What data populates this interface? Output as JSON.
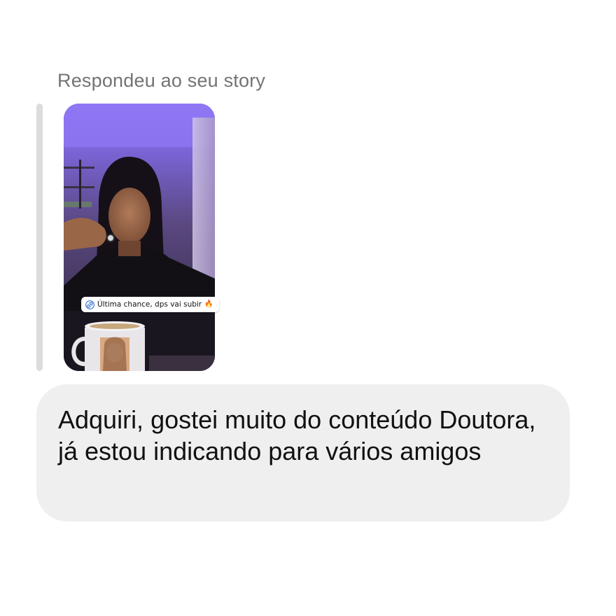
{
  "reply": {
    "caption": "Respondeu ao seu story"
  },
  "story": {
    "sticker_text": "Última chance, dps vai subir",
    "sticker_emoji": "🔥",
    "link_icon": "link-icon",
    "colors": {
      "light_glow": "#8a6cf0",
      "wall": "#5c4b7a"
    }
  },
  "message": {
    "text": "Adquiri, gostei muito do conteúdo Doutora, já estou indicando para vários amigos"
  },
  "colors": {
    "bubble_bg": "#efefef",
    "caption_text": "#737373",
    "reply_bar": "#dcdcdc"
  }
}
